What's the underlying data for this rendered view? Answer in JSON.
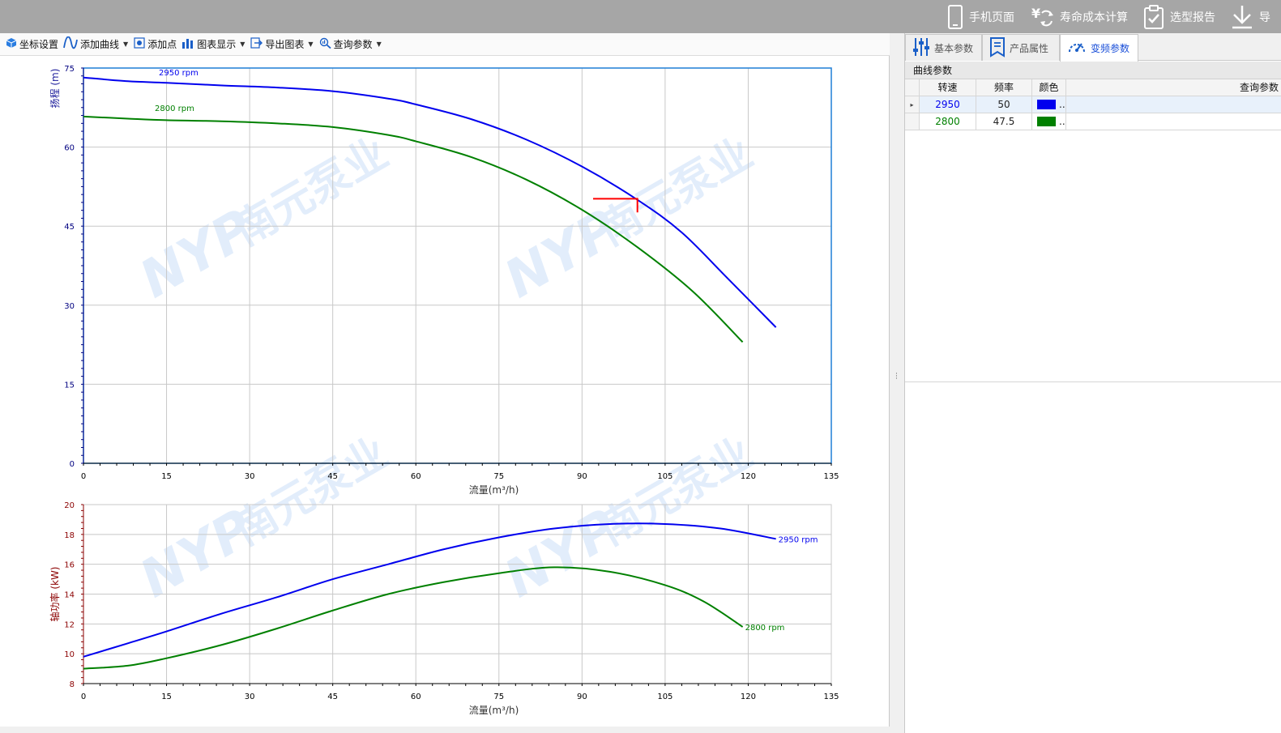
{
  "topbar": {
    "items": [
      {
        "name": "mobile-page-button",
        "label": "手机页面",
        "icon": "phone-icon"
      },
      {
        "name": "life-cost-button",
        "label": "寿命成本计算",
        "icon": "yuan-cost-icon"
      },
      {
        "name": "selection-report-button",
        "label": "选型报告",
        "icon": "clipboard-check-icon"
      },
      {
        "name": "export-button",
        "label": "导",
        "icon": "download-icon"
      }
    ]
  },
  "toolbar": {
    "axis_settings": "坐标设置",
    "add_curve": "添加曲线",
    "add_point": "添加点",
    "chart_display": "图表显示",
    "export_chart": "导出图表",
    "query_params": "查询参数"
  },
  "watermark": {
    "logo": "NYP",
    "company": "南元泵业"
  },
  "chart_data": [
    {
      "type": "line",
      "xlabel": "流量(m³/h)",
      "ylabel": "扬程 (m)",
      "xlim": [
        0,
        135
      ],
      "ylim": [
        0,
        75
      ],
      "xticks": [
        0,
        15,
        30,
        45,
        60,
        75,
        90,
        105,
        120,
        135
      ],
      "yticks": [
        0,
        15,
        30,
        45,
        60,
        75
      ],
      "grid": true,
      "series": [
        {
          "name": "2950 rpm",
          "color": "#0000ee",
          "x": [
            0,
            8,
            15,
            25,
            35,
            45,
            55,
            60,
            70,
            80,
            90,
            100,
            108,
            116,
            125
          ],
          "y": [
            73.2,
            72.5,
            72.2,
            71.7,
            71.3,
            70.6,
            69.2,
            68.1,
            65.3,
            61.4,
            56.3,
            50.0,
            43.8,
            35.4,
            25.8
          ]
        },
        {
          "name": "2800 rpm",
          "color": "#008000",
          "x": [
            0,
            8,
            15,
            25,
            35,
            45,
            55,
            60,
            70,
            80,
            90,
            100,
            110,
            119
          ],
          "y": [
            65.8,
            65.4,
            65.1,
            64.9,
            64.5,
            63.8,
            62.3,
            61.1,
            58.1,
            53.8,
            48.1,
            41.0,
            32.6,
            23.0
          ]
        }
      ],
      "annotations": [
        {
          "type": "marker",
          "color": "#ff0000",
          "x": [
            92,
            100,
            100
          ],
          "y": [
            50.2,
            50.2,
            47.6
          ]
        }
      ]
    },
    {
      "type": "line",
      "xlabel": "流量(m³/h)",
      "ylabel": "轴功率 (kW)",
      "xlim": [
        0,
        135
      ],
      "ylim": [
        8,
        20
      ],
      "xticks": [
        0,
        15,
        30,
        45,
        60,
        75,
        90,
        105,
        120,
        135
      ],
      "yticks": [
        8,
        10,
        12,
        14,
        16,
        18,
        20
      ],
      "grid": true,
      "series": [
        {
          "name": "2950 rpm",
          "color": "#0000ee",
          "x": [
            0,
            8,
            15,
            25,
            35,
            45,
            55,
            65,
            75,
            85,
            95,
            105,
            115,
            125
          ],
          "y": [
            9.8,
            10.7,
            11.5,
            12.7,
            13.8,
            15.0,
            16.0,
            17.0,
            17.8,
            18.4,
            18.7,
            18.7,
            18.4,
            17.7
          ]
        },
        {
          "name": "2800 rpm",
          "color": "#008000",
          "x": [
            0,
            8,
            15,
            25,
            35,
            45,
            55,
            65,
            75,
            85,
            95,
            105,
            112,
            119
          ],
          "y": [
            9.0,
            9.2,
            9.7,
            10.6,
            11.7,
            12.9,
            14.0,
            14.8,
            15.4,
            15.8,
            15.5,
            14.6,
            13.5,
            11.8
          ]
        }
      ]
    }
  ],
  "right_panel": {
    "tabs": [
      {
        "name": "tab-basic-params",
        "label": "基本参数",
        "icon": "sliders-icon",
        "active": false
      },
      {
        "name": "tab-product-attrs",
        "label": "产品属性",
        "icon": "bookmark-doc-icon",
        "active": false
      },
      {
        "name": "tab-vfd-params",
        "label": "变频参数",
        "icon": "speed-gauge-icon",
        "active": true
      }
    ],
    "group_title": "曲线参数",
    "columns": [
      "转速",
      "频率",
      "颜色",
      "查询参数"
    ],
    "rows": [
      {
        "speed": "2950",
        "freq": "50",
        "color": "#0000ee",
        "color_label": "..",
        "selected": true
      },
      {
        "speed": "2800",
        "freq": "47.5",
        "color": "#008000",
        "color_label": "..",
        "selected": false
      }
    ]
  }
}
